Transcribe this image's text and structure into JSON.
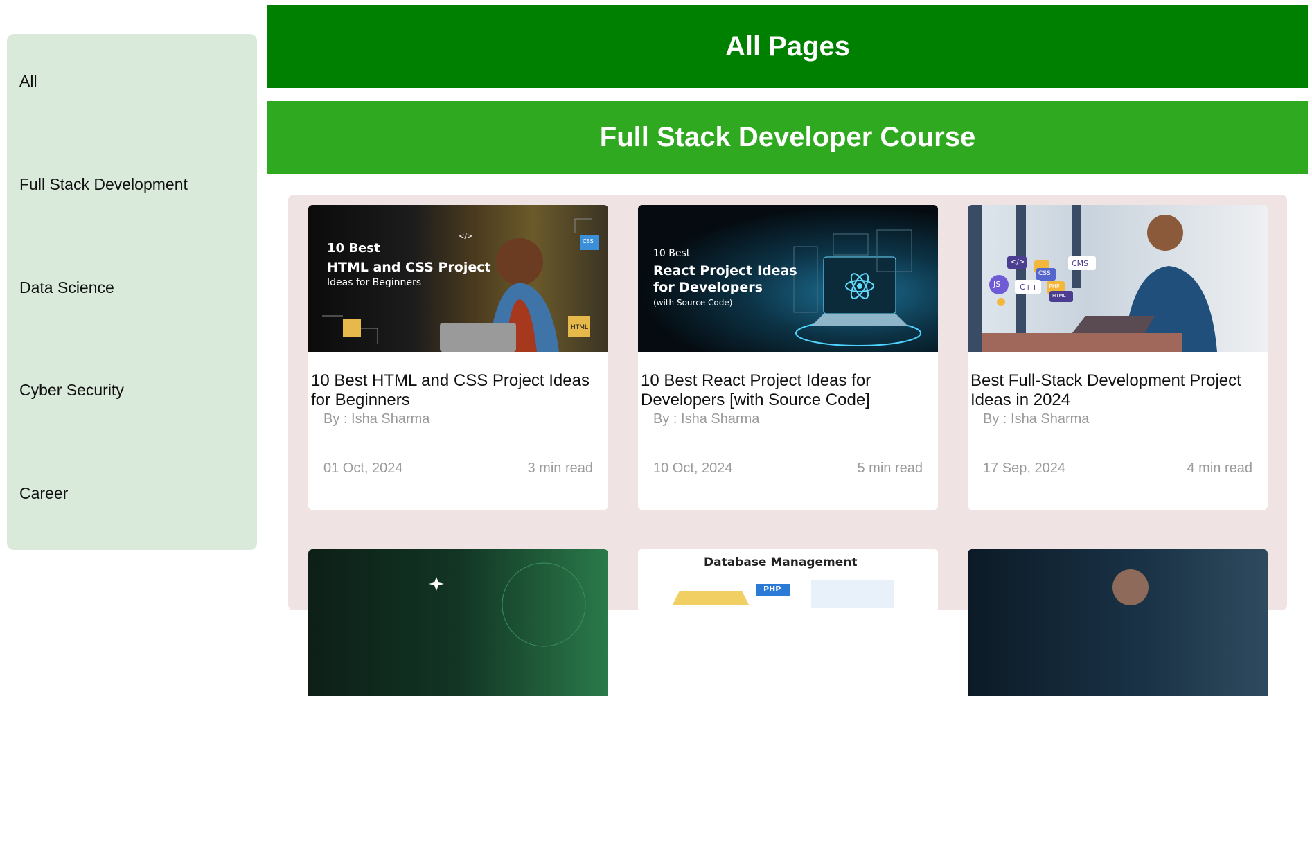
{
  "sidebar": {
    "items": [
      {
        "label": "All"
      },
      {
        "label": "Full Stack Development"
      },
      {
        "label": "Data Science"
      },
      {
        "label": "Cyber Security"
      },
      {
        "label": "Career"
      }
    ]
  },
  "header": {
    "title": "All Pages",
    "subtitle": "Full Stack Developer Course"
  },
  "cards": [
    {
      "title": "10 Best HTML and CSS Project Ideas for Beginners",
      "author": "By : Isha Sharma",
      "date": "01 Oct, 2024",
      "read_time": "3 min read",
      "thumb_lines": [
        "10 Best",
        "HTML and CSS Project",
        "Ideas for Beginners"
      ],
      "thumb_badges": [
        "CSS",
        "HTML",
        "</>"
      ]
    },
    {
      "title": "10 Best React Project Ideas for Developers [with Source Code]",
      "author": "By : Isha Sharma",
      "date": "10 Oct, 2024",
      "read_time": "5 min read",
      "thumb_lines": [
        "10 Best",
        "React Project Ideas",
        "for Developers",
        "(with Source Code)"
      ]
    },
    {
      "title": "Best Full-Stack Development Project Ideas in 2024",
      "author": "By : Isha Sharma",
      "date": "17 Sep, 2024",
      "read_time": "4 min read",
      "thumb_badges": [
        "</>",
        "CSS",
        "CMS",
        "JS",
        "C++",
        "PHP",
        "HTML"
      ]
    }
  ],
  "next_row": {
    "card2_heading": "Database Management",
    "card2_badge": "PHP"
  },
  "colors": {
    "header_primary": "#008000",
    "header_secondary": "#2fa91f",
    "sidebar_bg": "#d9eadb",
    "grid_bg": "#efe4e3"
  }
}
